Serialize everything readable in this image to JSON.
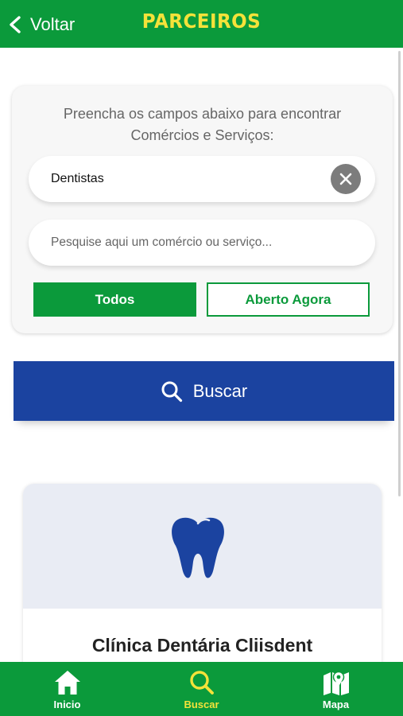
{
  "header": {
    "back_label": "Voltar",
    "title": "PARCEIROS"
  },
  "filter": {
    "instruction": "Preencha os campos abaixo para encontrar Comércios e Serviços:",
    "category_value": "Dentistas",
    "search_placeholder": "Pesquise aqui um comércio ou serviço...",
    "segments": {
      "all_label": "Todos",
      "open_now_label": "Aberto Agora",
      "selected": "Todos"
    }
  },
  "search_button": {
    "label": "Buscar"
  },
  "results": [
    {
      "name": "Clínica Dentária Cliisdent",
      "icon": "tooth-icon"
    }
  ],
  "tabbar": {
    "items": [
      {
        "label": "Inicio",
        "icon": "home-icon"
      },
      {
        "label": "Buscar",
        "icon": "search-icon",
        "active": true
      },
      {
        "label": "Mapa",
        "icon": "map-icon"
      }
    ]
  },
  "colors": {
    "brand_green": "#0b9a3b",
    "title_yellow": "#f4e23a",
    "primary_blue": "#1b43a0",
    "clear_gray": "#7c7c7c"
  }
}
